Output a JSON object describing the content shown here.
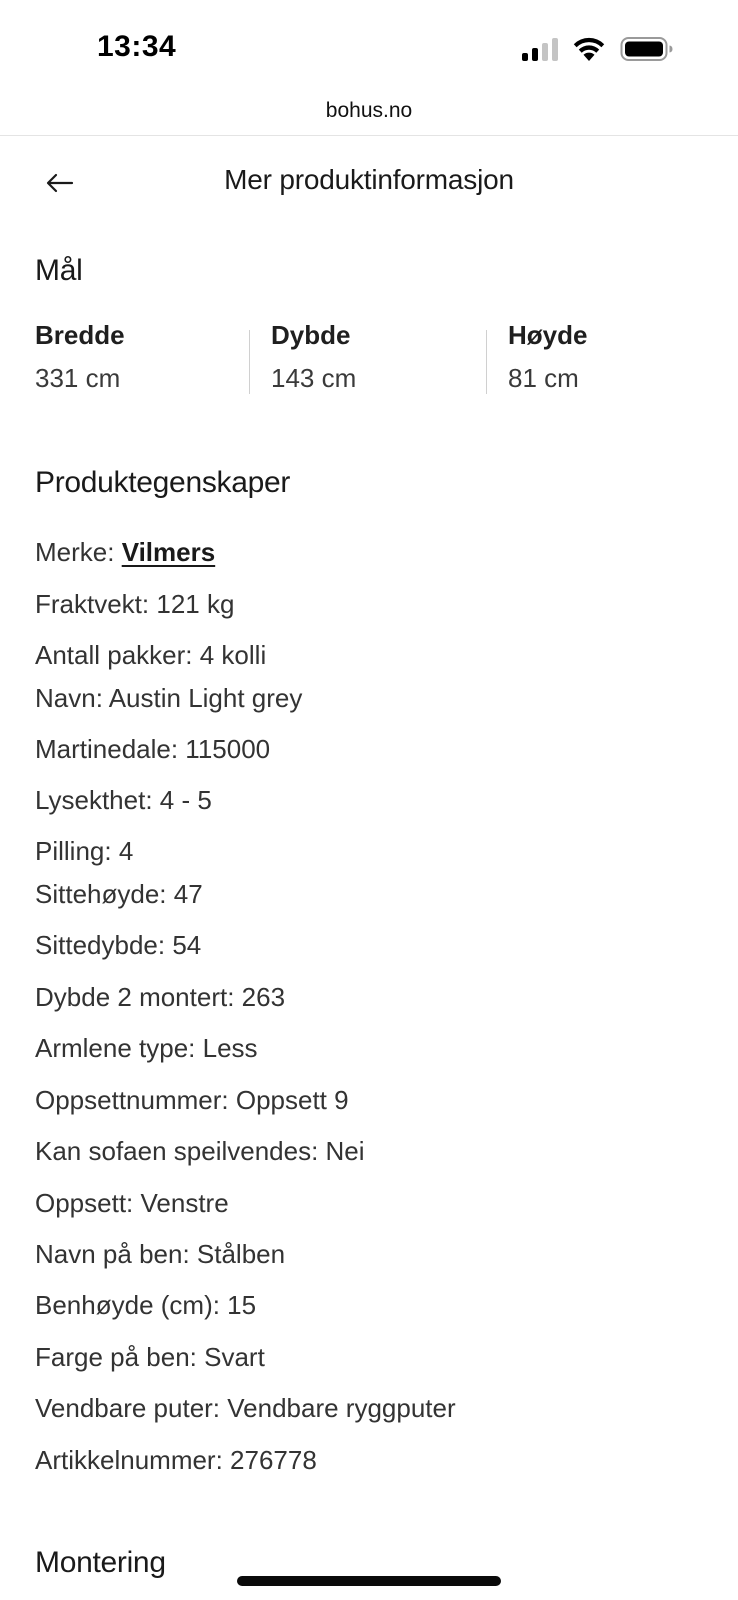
{
  "status_bar": {
    "time": "13:34",
    "icons": [
      "cellular-signal-icon",
      "wifi-icon",
      "battery-icon"
    ]
  },
  "browser": {
    "url": "bohus.no"
  },
  "header": {
    "title": "Mer produktinformasjon",
    "back_icon": "arrow-left-icon"
  },
  "dimensions": {
    "heading": "Mål",
    "items": [
      {
        "label": "Bredde",
        "value": "331 cm"
      },
      {
        "label": "Dybde",
        "value": "143 cm"
      },
      {
        "label": "Høyde",
        "value": "81 cm"
      }
    ]
  },
  "properties": {
    "heading": "Produktegenskaper",
    "brand_label": "Merke:",
    "brand_value": "Vilmers",
    "items": [
      "Fraktvekt: 121 kg",
      "Antall pakker: 4 kolli",
      "Navn: Austin Light grey",
      "Martinedale: 115000",
      "Lysekthet: 4 - 5",
      "Pilling: 4",
      "Sittehøyde: 47",
      "Sittedybde: 54",
      "Dybde 2 montert: 263",
      "Armlene type: Less",
      "Oppsettnummer: Oppsett 9",
      "Kan sofaen speilvendes: Nei",
      "Oppsett: Venstre",
      "Navn på ben: Stålben",
      "Benhøyde (cm): 15",
      "Farge på ben: Svart",
      "Vendbare puter: Vendbare ryggputer",
      "Artikkelnummer: 276778"
    ]
  },
  "montering": {
    "heading": "Montering"
  }
}
